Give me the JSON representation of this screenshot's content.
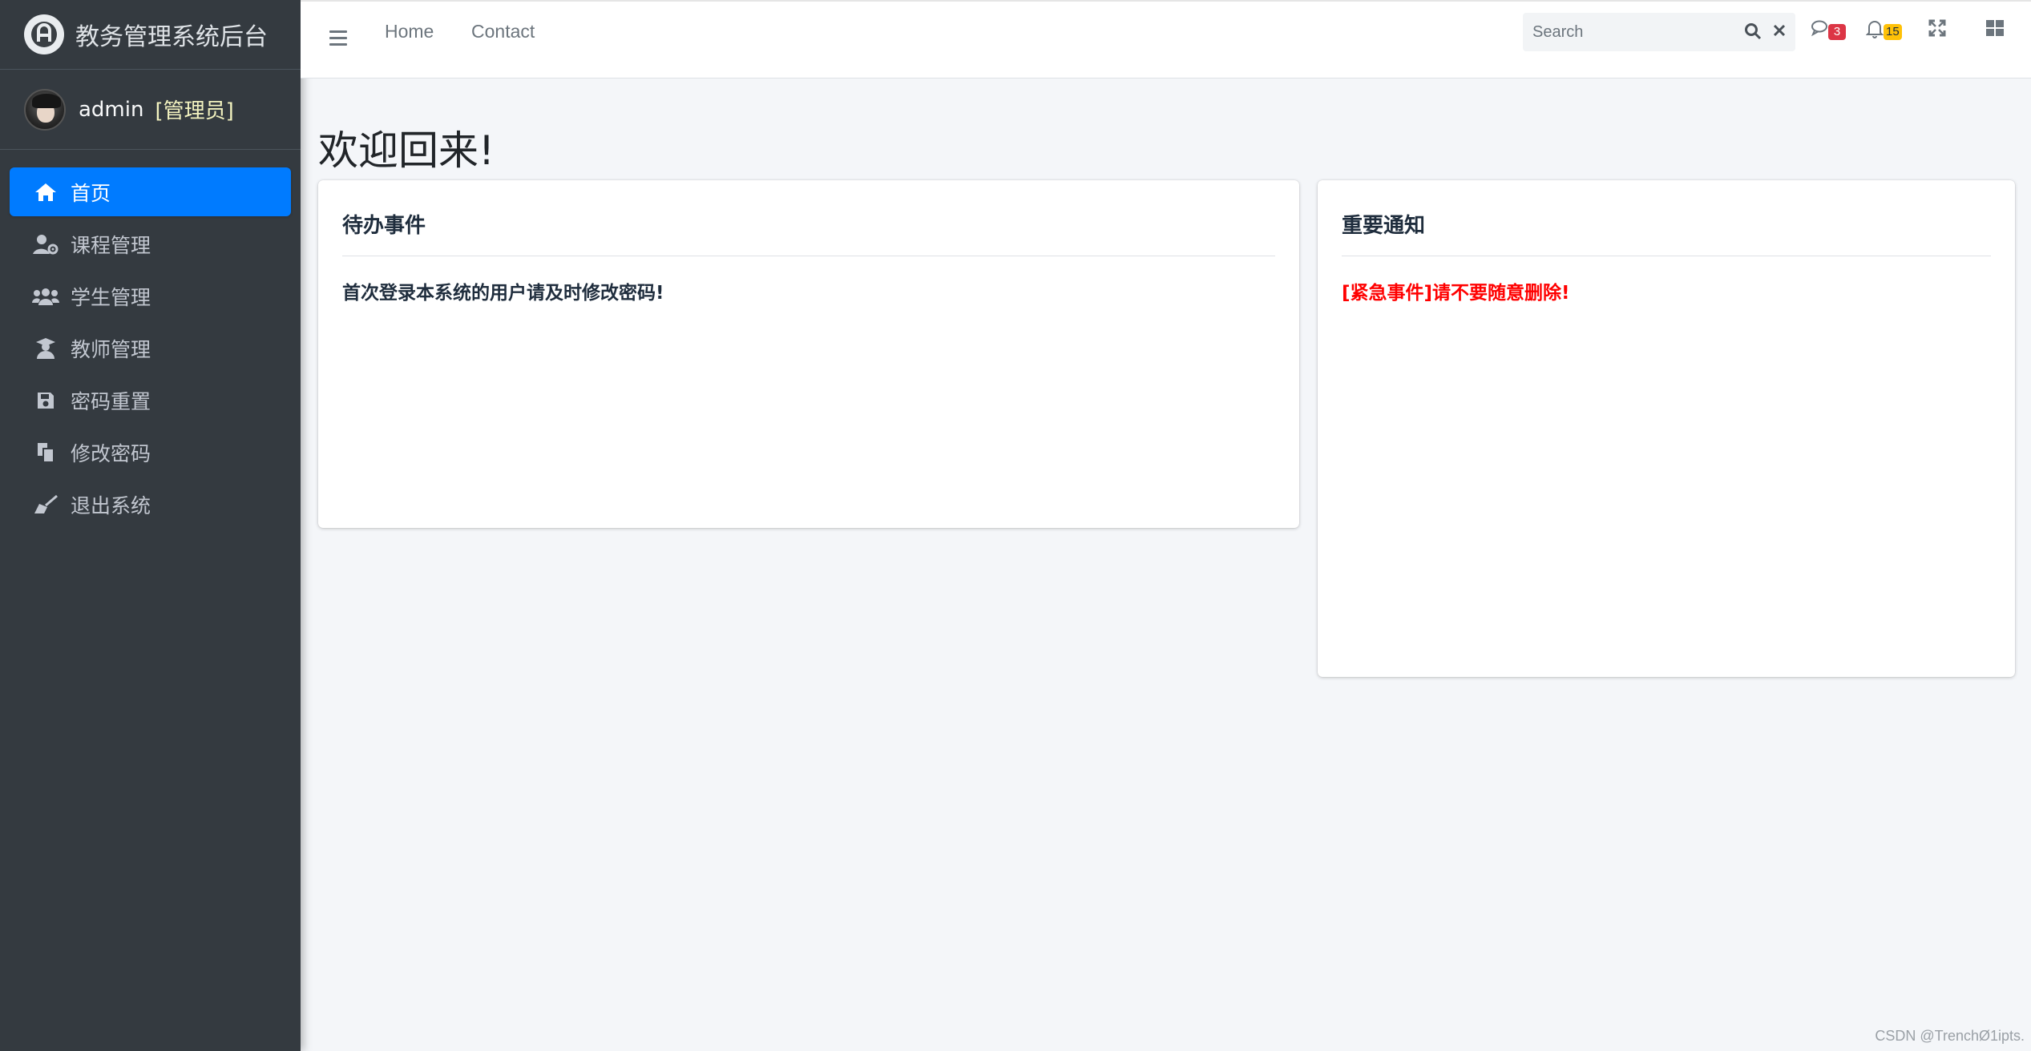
{
  "brand": {
    "title": "教务管理系统后台"
  },
  "user": {
    "name": "admin",
    "role": "[管理员]"
  },
  "sidebar": {
    "items": [
      {
        "label": "首页",
        "icon": "home-icon",
        "active": true
      },
      {
        "label": "课程管理",
        "icon": "user-gear-icon",
        "active": false
      },
      {
        "label": "学生管理",
        "icon": "users-icon",
        "active": false
      },
      {
        "label": "教师管理",
        "icon": "teacher-icon",
        "active": false
      },
      {
        "label": "密码重置",
        "icon": "save-icon",
        "active": false
      },
      {
        "label": "修改密码",
        "icon": "copy-icon",
        "active": false
      },
      {
        "label": "退出系统",
        "icon": "broom-icon",
        "active": false
      }
    ]
  },
  "navbar": {
    "links": [
      "Home",
      "Contact"
    ],
    "search": {
      "placeholder": "Search",
      "value": ""
    },
    "messages_count": "3",
    "notifications_count": "15"
  },
  "main": {
    "title": "欢迎回来!",
    "cards": [
      {
        "title": "待办事件",
        "text": "首次登录本系统的用户请及时修改密码!",
        "text_color": "#1f2d3d"
      },
      {
        "title": "重要通知",
        "text": "[紧急事件]请不要随意删除!",
        "text_color": "#ff0000"
      }
    ]
  },
  "colors": {
    "sidebar_bg": "#343a40",
    "active_item": "#007bff",
    "danger_badge": "#dc3545",
    "warning_badge": "#ffc107",
    "urgent_text": "#ff0000"
  },
  "watermark": "CSDN @TrenchØ1ipts."
}
